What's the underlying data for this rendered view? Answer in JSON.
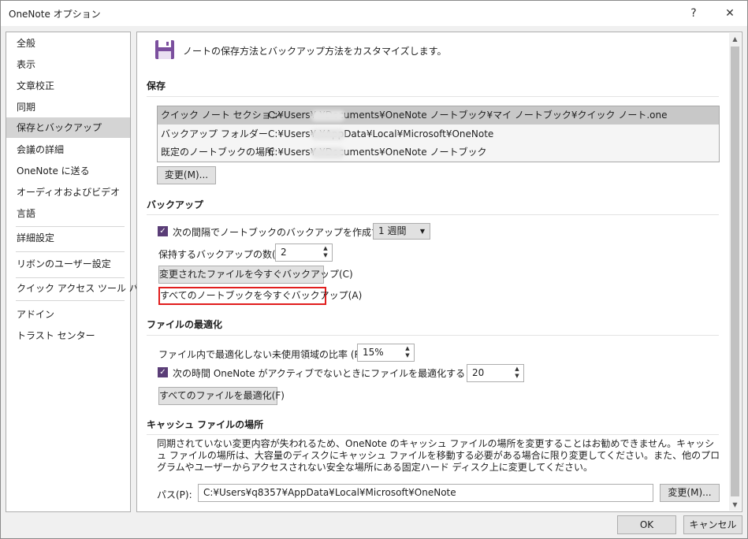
{
  "window": {
    "title": "OneNote オプション",
    "help_glyph": "?",
    "close_glyph": "✕"
  },
  "sidebar": {
    "items": [
      {
        "label": "全般"
      },
      {
        "label": "表示"
      },
      {
        "label": "文章校正"
      },
      {
        "label": "同期"
      },
      {
        "label": "保存とバックアップ",
        "selected": true
      },
      {
        "label": "会議の詳細"
      },
      {
        "label": "OneNote に送る"
      },
      {
        "label": "オーディオおよびビデオ"
      },
      {
        "label": "言語"
      },
      {
        "label": "詳細設定"
      },
      {
        "label": "リボンのユーザー設定"
      },
      {
        "label": "クイック アクセス ツール バー"
      },
      {
        "label": "アドイン"
      },
      {
        "label": "トラスト センター"
      }
    ]
  },
  "header": {
    "icon": "save-icon",
    "text": "ノートの保存方法とバックアップ方法をカスタマイズします。"
  },
  "save": {
    "title": "保存",
    "rows": [
      {
        "name": "クイック ノート セクション",
        "path": "C:¥Users¥        ¥Documents¥OneNote ノートブック¥マイ ノートブック¥クイック ノート.one"
      },
      {
        "name": "バックアップ フォルダー",
        "path": "C:¥Users¥        ¥AppData¥Local¥Microsoft¥OneNote"
      },
      {
        "name": "既定のノートブックの場所",
        "path": "C:¥Users¥        ¥Documents¥OneNote ノートブック"
      }
    ],
    "change_button": "変更(M)..."
  },
  "backup": {
    "title": "バックアップ",
    "auto_backup_label": "次の間隔でノートブックのバックアップを作成する(U):",
    "interval_value": "1 週間",
    "count_label": "保持するバックアップの数(B):",
    "count_value": "2",
    "backup_changed_button": "変更されたファイルを今すぐバックアップ(C)",
    "backup_all_button": "すべてのノートブックを今すぐバックアップ(A)"
  },
  "optimize": {
    "title": "ファイルの最適化",
    "unused_ratio_label": "ファイル内で最適化しない未使用領域の比率 (R):",
    "unused_ratio_value": "15%",
    "idle_label": "次の時間 OneNote がアクティブでないときにファイルを最適化する (分)(O):",
    "idle_value": "20",
    "optimize_all_button": "すべてのファイルを最適化(F)"
  },
  "cache": {
    "title": "キャッシュ ファイルの場所",
    "description": "同期されていない変更内容が失われるため、OneNote のキャッシュ ファイルの場所を変更することはお勧めできません。キャッシュ ファイルの場所は、大容量のディスクにキャッシュ ファイルを移動する必要がある場合に限り変更してください。また、他のプログラムやユーザーからアクセスされない安全な場所にある固定ハード ディスク上に変更してください。",
    "path_label": "パス(P):",
    "path_value": "C:¥Users¥q8357¥AppData¥Local¥Microsoft¥OneNote",
    "change_button": "変更(M)..."
  },
  "footer": {
    "ok": "OK",
    "cancel": "キャンセル"
  },
  "colors": {
    "checkbox": "#5a3d77",
    "highlight_border": "#e11d1d",
    "selected_nav": "#d4d4d4"
  }
}
